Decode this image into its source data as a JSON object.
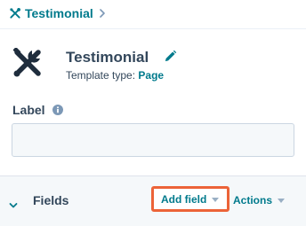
{
  "breadcrumb": {
    "label": "Testimonial",
    "icon": "tools-icon",
    "chevron_icon": "chevron-right-icon"
  },
  "module": {
    "title": "Testimonial",
    "icon": "tools-icon",
    "edit_icon": "pencil-icon",
    "template_type_label": "Template type:",
    "template_type_value": "Page"
  },
  "label_field": {
    "label": "Label",
    "info_icon": "info-icon",
    "value": "",
    "placeholder": ""
  },
  "fields_section": {
    "title": "Fields",
    "toggle_icon": "chevron-down-icon",
    "add_field_label": "Add field",
    "actions_label": "Actions",
    "highlight_color": "#ec6338"
  },
  "colors": {
    "accent": "#007a8c",
    "text": "#33475b",
    "muted": "#7c98b6",
    "panel_bg": "#f5f8fa",
    "border": "#cbd6e2",
    "highlight": "#ec6338"
  }
}
